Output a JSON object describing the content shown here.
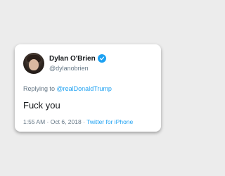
{
  "tweet": {
    "author_name": "Dylan O'Brien",
    "author_handle": "@dylanobrien",
    "verified": true,
    "reply_prefix": "Replying to ",
    "reply_mention": "@realDonaldTrump",
    "text": "Fuck you",
    "time": "1:55 AM",
    "separator": " · ",
    "date": "Oct 6, 2018",
    "source_sep": " · ",
    "source": "Twitter for iPhone"
  },
  "colors": {
    "background": "#ececec",
    "card": "#ffffff",
    "accent": "#1da1f2",
    "secondary_text": "#657786",
    "primary_text": "#14171a"
  },
  "icons": {
    "avatar": "avatar",
    "verified": "verified-badge-icon"
  }
}
